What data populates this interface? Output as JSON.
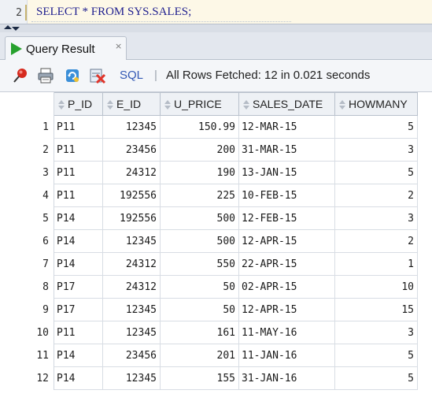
{
  "editor": {
    "line_number": "2",
    "sql_text": "SELECT * FROM SYS.SALES;"
  },
  "tab": {
    "label": "Query Result",
    "close_glyph": "×"
  },
  "toolbar": {
    "icons": [
      "pin-icon",
      "print-icon",
      "refresh-icon",
      "export-icon"
    ],
    "sql_label": "SQL",
    "separator": "|",
    "status": "All Rows Fetched: 12 in 0.021 seconds"
  },
  "grid": {
    "columns": [
      "P_ID",
      "E_ID",
      "U_PRICE",
      "SALES_DATE",
      "HOWMANY"
    ],
    "rows": [
      {
        "n": "1",
        "P_ID": "P11",
        "E_ID": "12345",
        "U_PRICE": "150.99",
        "SALES_DATE": "12-MAR-15",
        "HOWMANY": "5"
      },
      {
        "n": "2",
        "P_ID": "P11",
        "E_ID": "23456",
        "U_PRICE": "200",
        "SALES_DATE": "31-MAR-15",
        "HOWMANY": "3"
      },
      {
        "n": "3",
        "P_ID": "P11",
        "E_ID": "24312",
        "U_PRICE": "190",
        "SALES_DATE": "13-JAN-15",
        "HOWMANY": "5"
      },
      {
        "n": "4",
        "P_ID": "P11",
        "E_ID": "192556",
        "U_PRICE": "225",
        "SALES_DATE": "10-FEB-15",
        "HOWMANY": "2"
      },
      {
        "n": "5",
        "P_ID": "P14",
        "E_ID": "192556",
        "U_PRICE": "500",
        "SALES_DATE": "12-FEB-15",
        "HOWMANY": "3"
      },
      {
        "n": "6",
        "P_ID": "P14",
        "E_ID": "12345",
        "U_PRICE": "500",
        "SALES_DATE": "12-APR-15",
        "HOWMANY": "2"
      },
      {
        "n": "7",
        "P_ID": "P14",
        "E_ID": "24312",
        "U_PRICE": "550",
        "SALES_DATE": "22-APR-15",
        "HOWMANY": "1"
      },
      {
        "n": "8",
        "P_ID": "P17",
        "E_ID": "24312",
        "U_PRICE": "50",
        "SALES_DATE": "02-APR-15",
        "HOWMANY": "10"
      },
      {
        "n": "9",
        "P_ID": "P17",
        "E_ID": "12345",
        "U_PRICE": "50",
        "SALES_DATE": "12-APR-15",
        "HOWMANY": "15"
      },
      {
        "n": "10",
        "P_ID": "P11",
        "E_ID": "12345",
        "U_PRICE": "161",
        "SALES_DATE": "11-MAY-16",
        "HOWMANY": "3"
      },
      {
        "n": "11",
        "P_ID": "P14",
        "E_ID": "23456",
        "U_PRICE": "201",
        "SALES_DATE": "11-JAN-16",
        "HOWMANY": "5"
      },
      {
        "n": "12",
        "P_ID": "P14",
        "E_ID": "12345",
        "U_PRICE": "155",
        "SALES_DATE": "31-JAN-16",
        "HOWMANY": "5"
      }
    ]
  },
  "colors": {
    "accent_link": "#3359b5",
    "run_green": "#27a12e",
    "sql_text": "#1f1f8f"
  }
}
